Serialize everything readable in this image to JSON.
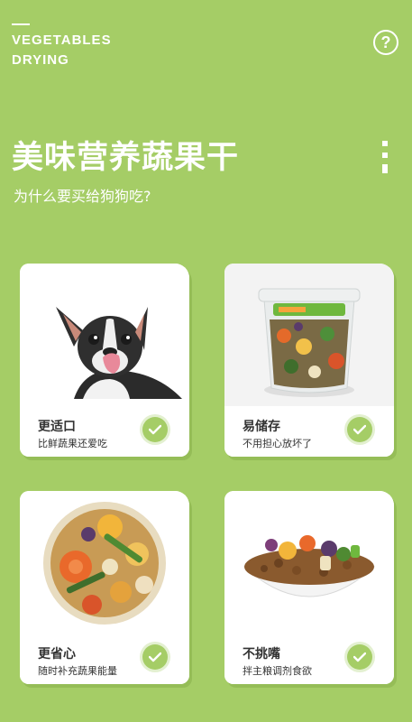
{
  "brand": {
    "line1": "VEGETABLES",
    "line2": "DRYING"
  },
  "header": {
    "title": "美味营养蔬果干",
    "subtitle": "为什么要买给狗狗吃?"
  },
  "cards": [
    {
      "name": "更适口",
      "desc": "比鲜蔬果还爱吃",
      "icon": "dog-photo"
    },
    {
      "name": "易储存",
      "desc": "不用担心放坏了",
      "icon": "snack-jar-photo"
    },
    {
      "name": "更省心",
      "desc": "随时补充蔬果能量",
      "icon": "dried-vegetables-plate-photo"
    },
    {
      "name": "不挑嘴",
      "desc": "拌主粮调剂食欲",
      "icon": "kibble-bowl-photo"
    }
  ],
  "colors": {
    "background": "#a5cd66",
    "accent": "#a5cd66",
    "card": "#ffffff"
  }
}
